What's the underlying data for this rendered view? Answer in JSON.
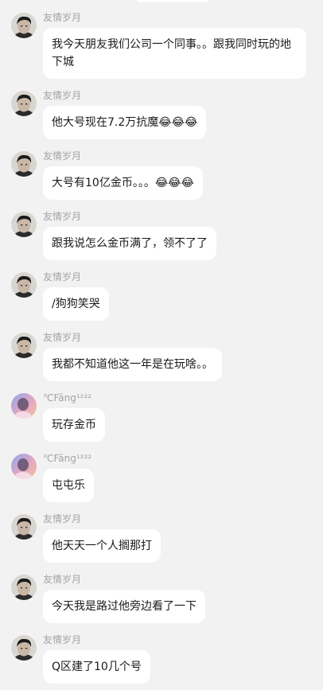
{
  "messages": [
    {
      "sender": "友情岁月",
      "text": "我今天朋友我们公司一个同事。。跟我同时玩的地下城",
      "avatar": "friend-avatar"
    },
    {
      "sender": "友情岁月",
      "text": "他大号现在7.2万抗魔😂😂😂",
      "avatar": "friend-avatar"
    },
    {
      "sender": "友情岁月",
      "text": "大号有10亿金币。。。😂😂😂",
      "avatar": "friend-avatar"
    },
    {
      "sender": "友情岁月",
      "text": "跟我说怎么金币满了，领不了了",
      "avatar": "friend-avatar"
    },
    {
      "sender": "友情岁月",
      "text": "/狗狗笑哭",
      "avatar": "friend-avatar"
    },
    {
      "sender": "友情岁月",
      "text": "我都不知道他这一年是在玩啥。。",
      "avatar": "friend-avatar"
    },
    {
      "sender": "℃Fāng¹²²²",
      "text": "玩存金币",
      "avatar": "fang-avatar"
    },
    {
      "sender": "℃Fāng¹²²²",
      "text": "屯屯乐",
      "avatar": "fang-avatar"
    },
    {
      "sender": "友情岁月",
      "text": "他天天一个人搁那打",
      "avatar": "friend-avatar"
    },
    {
      "sender": "友情岁月",
      "text": "今天我是路过他旁边看了一下",
      "avatar": "friend-avatar"
    },
    {
      "sender": "友情岁月",
      "text": "Q区建了10几个号",
      "avatar": "friend-avatar"
    }
  ]
}
